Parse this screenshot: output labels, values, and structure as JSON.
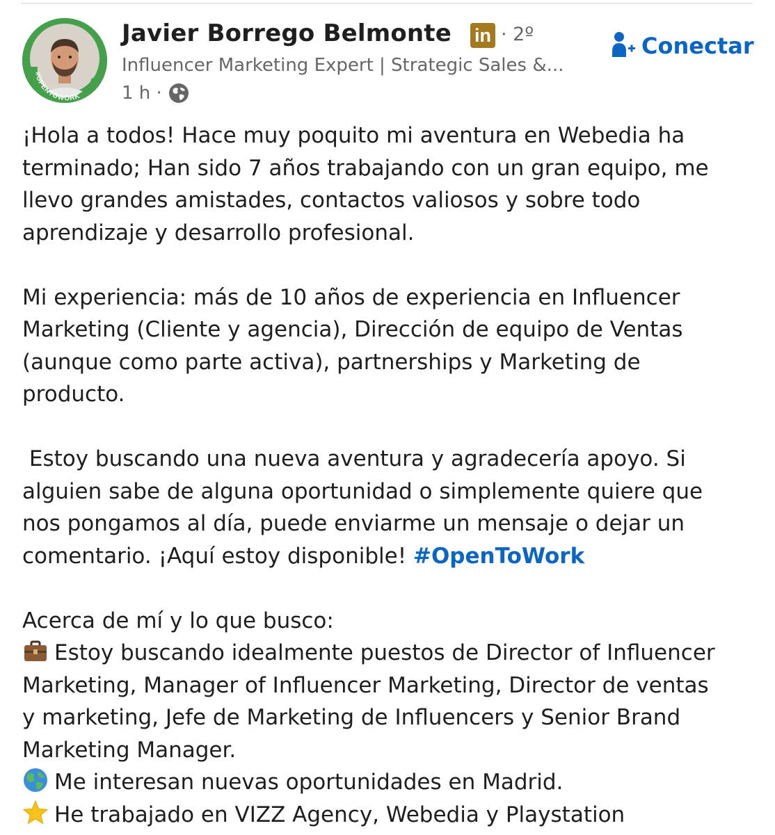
{
  "post": {
    "author": {
      "name": "Javier Borrego Belmonte",
      "badge": "in",
      "degree": "· 2º",
      "headline": "Influencer Marketing Expert | Strategic Sales &...",
      "time": "1 h ·",
      "avatar_ring_text": "#OPENTOWORK"
    },
    "connect_label": "Conectar",
    "paragraph1": [
      "¡Hola a todos! Hace muy poquito mi aventura en Webedia ha",
      "terminado; Han sido 7 años trabajando con un gran equipo, me",
      "llevo grandes amistades, contactos valiosos y sobre todo",
      "aprendizaje y desarrollo profesional."
    ],
    "paragraph2": [
      "Mi experiencia: más de 10 años de experiencia en Influencer",
      "Marketing (Cliente y agencia), Dirección de equipo de Ventas",
      "(aunque como parte activa), partnerships y Marketing de",
      "producto."
    ],
    "paragraph3": [
      " Estoy buscando una nueva aventura y agradecería apoyo. Si",
      "alguien sabe de alguna oportunidad o simplemente quiere que",
      "nos pongamos al día, puede enviarme un mensaje o dejar un"
    ],
    "paragraph3_last": "comentario. ¡Aquí estoy disponible! ",
    "hashtag": "#OpenToWork",
    "about_heading": "Acerca de mí y lo que busco:",
    "bullet1": [
      "Estoy buscando idealmente puestos de Director of Influencer",
      "Marketing, Manager of Influencer Marketing, Director de ventas",
      "y marketing, Jefe de Marketing de Influencers y Senior Brand",
      "Marketing Manager."
    ],
    "bullet2": "Me interesan nuevas oportunidades en Madrid.",
    "bullet3": "He trabajado en VIZZ Agency, Webedia y Playstation",
    "icons": {
      "bullet1": "briefcase-icon",
      "bullet2": "globe-emoji-icon",
      "bullet3": "star-icon",
      "connect": "add-person-icon",
      "visibility": "globe-icon"
    },
    "colors": {
      "link": "#0a66c2",
      "opentowork_ring": "#44a04a",
      "secondary_text": "#666666"
    }
  }
}
